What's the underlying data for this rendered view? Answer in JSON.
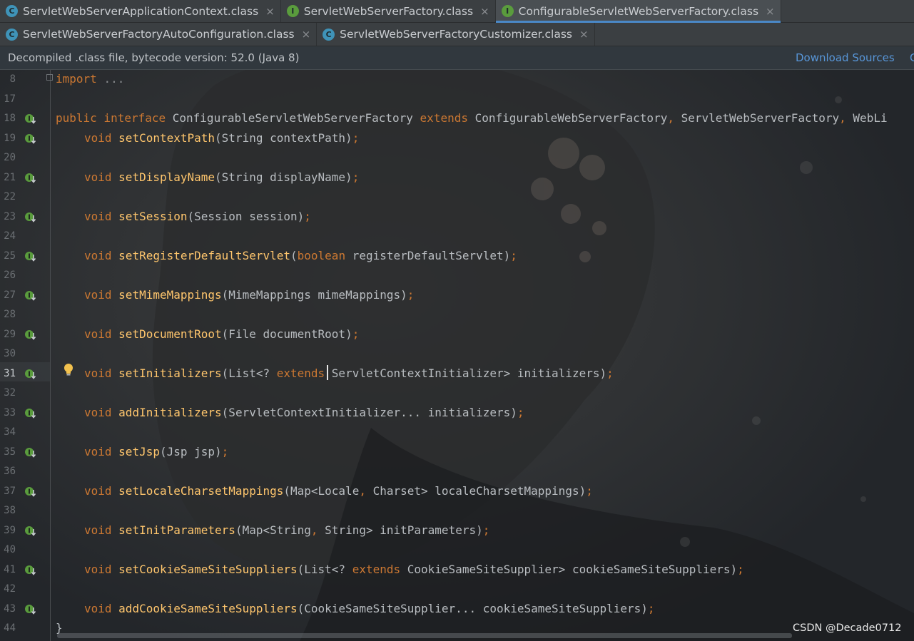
{
  "tabs_row1": [
    {
      "icon": "class-icon",
      "letter": "C",
      "label": "ServletWebServerApplicationContext.class",
      "active": false
    },
    {
      "icon": "interface-icon",
      "letter": "I",
      "label": "ServletWebServerFactory.class",
      "active": false
    },
    {
      "icon": "interface-icon",
      "letter": "I",
      "label": "ConfigurableServletWebServerFactory.class",
      "active": true
    }
  ],
  "tabs_row2": [
    {
      "icon": "class-icon",
      "letter": "C",
      "label": "ServletWebServerFactoryAutoConfiguration.class",
      "active": false
    },
    {
      "icon": "class-icon",
      "letter": "C",
      "label": "ServletWebServerFactoryCustomizer.class",
      "active": false
    }
  ],
  "close_glyph": "×",
  "banner": {
    "text": "Decompiled .class file, bytecode version: 52.0 (Java 8)",
    "download_label": "Download Sources",
    "extra_label": "C"
  },
  "lines": [
    {
      "n": "8",
      "tokens": [
        [
          "kw",
          "import"
        ],
        [
          "ty",
          " "
        ],
        [
          "fold",
          "..."
        ]
      ],
      "indent": false,
      "icon": false
    },
    {
      "n": "17",
      "tokens": [],
      "indent": false,
      "icon": false
    },
    {
      "n": "18",
      "tokens": [
        [
          "kw",
          "public interface "
        ],
        [
          "ty",
          "ConfigurableServletWebServerFactory "
        ],
        [
          "kw",
          "extends "
        ],
        [
          "ty",
          "ConfigurableWebServerFactory"
        ],
        [
          "pn",
          ", "
        ],
        [
          "ty",
          "ServletWebServerFactory"
        ],
        [
          "pn",
          ", "
        ],
        [
          "ty",
          "WebLi"
        ]
      ],
      "indent": false,
      "icon": true
    },
    {
      "n": "19",
      "tokens": [
        [
          "kw",
          "void "
        ],
        [
          "fn",
          "setContextPath"
        ],
        [
          "ty",
          "(String contextPath)"
        ],
        [
          "pn",
          ";"
        ]
      ],
      "indent": true,
      "icon": true
    },
    {
      "n": "20",
      "tokens": [],
      "indent": false,
      "icon": false
    },
    {
      "n": "21",
      "tokens": [
        [
          "kw",
          "void "
        ],
        [
          "fn",
          "setDisplayName"
        ],
        [
          "ty",
          "(String displayName)"
        ],
        [
          "pn",
          ";"
        ]
      ],
      "indent": true,
      "icon": true
    },
    {
      "n": "22",
      "tokens": [],
      "indent": false,
      "icon": false
    },
    {
      "n": "23",
      "tokens": [
        [
          "kw",
          "void "
        ],
        [
          "fn",
          "setSession"
        ],
        [
          "ty",
          "(Session session)"
        ],
        [
          "pn",
          ";"
        ]
      ],
      "indent": true,
      "icon": true
    },
    {
      "n": "24",
      "tokens": [],
      "indent": false,
      "icon": false
    },
    {
      "n": "25",
      "tokens": [
        [
          "kw",
          "void "
        ],
        [
          "fn",
          "setRegisterDefaultServlet"
        ],
        [
          "ty",
          "("
        ],
        [
          "kw",
          "boolean "
        ],
        [
          "ty",
          "registerDefaultServlet)"
        ],
        [
          "pn",
          ";"
        ]
      ],
      "indent": true,
      "icon": true
    },
    {
      "n": "26",
      "tokens": [],
      "indent": false,
      "icon": false
    },
    {
      "n": "27",
      "tokens": [
        [
          "kw",
          "void "
        ],
        [
          "fn",
          "setMimeMappings"
        ],
        [
          "ty",
          "(MimeMappings mimeMappings)"
        ],
        [
          "pn",
          ";"
        ]
      ],
      "indent": true,
      "icon": true
    },
    {
      "n": "28",
      "tokens": [],
      "indent": false,
      "icon": false
    },
    {
      "n": "29",
      "tokens": [
        [
          "kw",
          "void "
        ],
        [
          "fn",
          "setDocumentRoot"
        ],
        [
          "ty",
          "(File documentRoot)"
        ],
        [
          "pn",
          ";"
        ]
      ],
      "indent": true,
      "icon": true
    },
    {
      "n": "30",
      "tokens": [],
      "indent": false,
      "icon": false
    },
    {
      "n": "31",
      "tokens": [
        [
          "kw",
          "void "
        ],
        [
          "fn",
          "setInitializers"
        ],
        [
          "ty",
          "(List<? "
        ],
        [
          "kw",
          "extends "
        ],
        [
          "ty",
          "ServletContextInitializer> initializers)"
        ],
        [
          "pn",
          ";"
        ]
      ],
      "indent": true,
      "icon": true,
      "current": true
    },
    {
      "n": "32",
      "tokens": [],
      "indent": false,
      "icon": false
    },
    {
      "n": "33",
      "tokens": [
        [
          "kw",
          "void "
        ],
        [
          "fn",
          "addInitializers"
        ],
        [
          "ty",
          "(ServletContextInitializer... initializers)"
        ],
        [
          "pn",
          ";"
        ]
      ],
      "indent": true,
      "icon": true
    },
    {
      "n": "34",
      "tokens": [],
      "indent": false,
      "icon": false
    },
    {
      "n": "35",
      "tokens": [
        [
          "kw",
          "void "
        ],
        [
          "fn",
          "setJsp"
        ],
        [
          "ty",
          "(Jsp jsp)"
        ],
        [
          "pn",
          ";"
        ]
      ],
      "indent": true,
      "icon": true
    },
    {
      "n": "36",
      "tokens": [],
      "indent": false,
      "icon": false
    },
    {
      "n": "37",
      "tokens": [
        [
          "kw",
          "void "
        ],
        [
          "fn",
          "setLocaleCharsetMappings"
        ],
        [
          "ty",
          "(Map<Locale"
        ],
        [
          "pn",
          ", "
        ],
        [
          "ty",
          "Charset> localeCharsetMappings)"
        ],
        [
          "pn",
          ";"
        ]
      ],
      "indent": true,
      "icon": true
    },
    {
      "n": "38",
      "tokens": [],
      "indent": false,
      "icon": false
    },
    {
      "n": "39",
      "tokens": [
        [
          "kw",
          "void "
        ],
        [
          "fn",
          "setInitParameters"
        ],
        [
          "ty",
          "(Map<String"
        ],
        [
          "pn",
          ", "
        ],
        [
          "ty",
          "String> initParameters)"
        ],
        [
          "pn",
          ";"
        ]
      ],
      "indent": true,
      "icon": true
    },
    {
      "n": "40",
      "tokens": [],
      "indent": false,
      "icon": false
    },
    {
      "n": "41",
      "tokens": [
        [
          "kw",
          "void "
        ],
        [
          "fn",
          "setCookieSameSiteSuppliers"
        ],
        [
          "ty",
          "(List<? "
        ],
        [
          "kw",
          "extends "
        ],
        [
          "ty",
          "CookieSameSiteSupplier> cookieSameSiteSuppliers)"
        ],
        [
          "pn",
          ";"
        ]
      ],
      "indent": true,
      "icon": true
    },
    {
      "n": "42",
      "tokens": [],
      "indent": false,
      "icon": false
    },
    {
      "n": "43",
      "tokens": [
        [
          "kw",
          "void "
        ],
        [
          "fn",
          "addCookieSameSiteSuppliers"
        ],
        [
          "ty",
          "(CookieSameSiteSupplier... cookieSameSiteSuppliers)"
        ],
        [
          "pn",
          ";"
        ]
      ],
      "indent": true,
      "icon": true
    },
    {
      "n": "44",
      "tokens": [
        [
          "ty",
          "}"
        ]
      ],
      "indent": false,
      "icon": false
    }
  ],
  "watermark": "CSDN @Decade0712",
  "colors": {
    "keyword": "#cc7832",
    "method": "#ffc66d",
    "text": "#b9bdc1",
    "link": "#5896d8",
    "accent": "#4a88c7"
  }
}
